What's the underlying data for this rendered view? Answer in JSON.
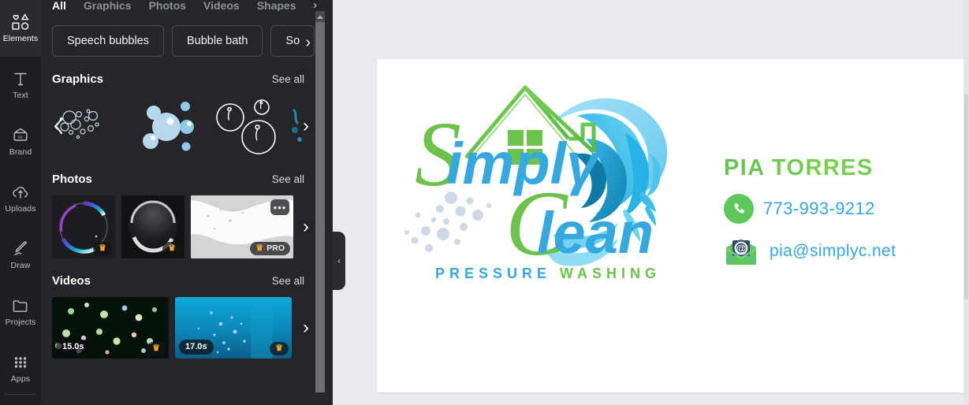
{
  "rail": {
    "items": [
      {
        "label": "Elements",
        "icon": "elements-icon",
        "active": true
      },
      {
        "label": "Text",
        "icon": "text-icon",
        "active": false
      },
      {
        "label": "Brand",
        "icon": "brand-icon",
        "active": false
      },
      {
        "label": "Uploads",
        "icon": "uploads-icon",
        "active": false
      },
      {
        "label": "Draw",
        "icon": "draw-icon",
        "active": false
      },
      {
        "label": "Projects",
        "icon": "projects-icon",
        "active": false
      },
      {
        "label": "Apps",
        "icon": "apps-icon",
        "active": false
      }
    ]
  },
  "panel": {
    "tabs": [
      {
        "label": "All",
        "active": true
      },
      {
        "label": "Graphics",
        "active": false
      },
      {
        "label": "Photos",
        "active": false
      },
      {
        "label": "Videos",
        "active": false
      },
      {
        "label": "Shapes",
        "active": false
      }
    ],
    "tabs_next": "›",
    "pills": [
      {
        "label": "Speech bubbles"
      },
      {
        "label": "Bubble bath"
      },
      {
        "label": "So"
      }
    ],
    "pill_next": "›",
    "sections": [
      {
        "title": "Graphics",
        "see_all": "See all",
        "prev": "‹",
        "next": "›",
        "items": [
          {
            "kind": "bubbles-outline-cluster"
          },
          {
            "kind": "bubbles-solid-blue"
          },
          {
            "kind": "bubbles-line-circles"
          },
          {
            "kind": "bubbles-teal-edge"
          }
        ]
      },
      {
        "title": "Photos",
        "see_all": "See all",
        "next": "›",
        "items": [
          {
            "kind": "soap-bubble-iridescent",
            "pro": true,
            "pro_label": ""
          },
          {
            "kind": "dark-bubble-sphere",
            "pro": true,
            "pro_label": ""
          },
          {
            "kind": "white-foam",
            "pro": true,
            "pro_label": "PRO",
            "more": "•••"
          }
        ]
      },
      {
        "title": "Videos",
        "see_all": "See all",
        "next": "›",
        "items": [
          {
            "kind": "bokeh-green-video",
            "duration": "15.0s",
            "pro": true
          },
          {
            "kind": "underwater-bubbles-video",
            "duration": "17.0s",
            "pro": true
          }
        ]
      }
    ],
    "collapse_chevron": "‹"
  },
  "design": {
    "logo": {
      "word_simply": "Simply",
      "word_clean": "Clean",
      "tagline": "PRESSURE WASHING",
      "colors": {
        "green": "#6cc24a",
        "blue": "#35a8e0",
        "wave_blue": "#1aa0d8",
        "wave_light": "#8fd6f2",
        "bubble": "#cfdce8"
      }
    },
    "contact": {
      "name": "PIA TORRES",
      "phone": "773-993-9212",
      "email": "pia@simplyc.net",
      "phone_icon": "phone-icon",
      "email_icon": "email-icon",
      "name_color": "#6cc24a",
      "text_color": "#34a5e8"
    }
  }
}
